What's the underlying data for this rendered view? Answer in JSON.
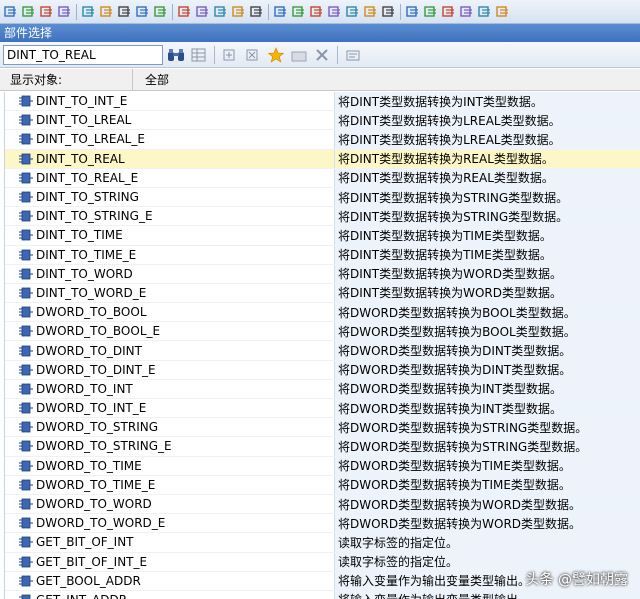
{
  "window": {
    "title": "部件选择"
  },
  "search": {
    "value": "DINT_TO_REAL"
  },
  "filter": {
    "label": "显示对象:",
    "value": "全部"
  },
  "colors": {
    "accent": "#3f72bd",
    "selected_row": "#fdf6c6",
    "desc_bg": "#edf3fb"
  },
  "toolbar_icons": [
    "cut-icon",
    "copy-icon",
    "paste-icon",
    "find-icon",
    "replace-icon",
    "goto-icon",
    "undo-icon",
    "redo-icon",
    "compile-icon",
    "download-icon",
    "upload-icon",
    "monitor-icon",
    "force-icon",
    "network-icon",
    "contact-icon",
    "coil-icon",
    "box-icon",
    "jump-icon",
    "return-icon",
    "comment-icon",
    "zoom-in-icon",
    "zoom-out-icon",
    "bookmark-icon",
    "tag-icon",
    "grid-icon",
    "print-icon",
    "settings-icon"
  ],
  "items": [
    {
      "name": "DINT_TO_INT_E",
      "desc": "将DINT类型数据转换为INT类型数据。"
    },
    {
      "name": "DINT_TO_LREAL",
      "desc": "将DINT类型数据转换为LREAL类型数据。"
    },
    {
      "name": "DINT_TO_LREAL_E",
      "desc": "将DINT类型数据转换为LREAL类型数据。"
    },
    {
      "name": "DINT_TO_REAL",
      "desc": "将DINT类型数据转换为REAL类型数据。",
      "selected": true
    },
    {
      "name": "DINT_TO_REAL_E",
      "desc": "将DINT类型数据转换为REAL类型数据。"
    },
    {
      "name": "DINT_TO_STRING",
      "desc": "将DINT类型数据转换为STRING类型数据。"
    },
    {
      "name": "DINT_TO_STRING_E",
      "desc": "将DINT类型数据转换为STRING类型数据。"
    },
    {
      "name": "DINT_TO_TIME",
      "desc": "将DINT类型数据转换为TIME类型数据。"
    },
    {
      "name": "DINT_TO_TIME_E",
      "desc": "将DINT类型数据转换为TIME类型数据。"
    },
    {
      "name": "DINT_TO_WORD",
      "desc": "将DINT类型数据转换为WORD类型数据。"
    },
    {
      "name": "DINT_TO_WORD_E",
      "desc": "将DINT类型数据转换为WORD类型数据。"
    },
    {
      "name": "DWORD_TO_BOOL",
      "desc": "将DWORD类型数据转换为BOOL类型数据。"
    },
    {
      "name": "DWORD_TO_BOOL_E",
      "desc": "将DWORD类型数据转换为BOOL类型数据。"
    },
    {
      "name": "DWORD_TO_DINT",
      "desc": "将DWORD类型数据转换为DINT类型数据。"
    },
    {
      "name": "DWORD_TO_DINT_E",
      "desc": "将DWORD类型数据转换为DINT类型数据。"
    },
    {
      "name": "DWORD_TO_INT",
      "desc": "将DWORD类型数据转换为INT类型数据。"
    },
    {
      "name": "DWORD_TO_INT_E",
      "desc": "将DWORD类型数据转换为INT类型数据。"
    },
    {
      "name": "DWORD_TO_STRING",
      "desc": "将DWORD类型数据转换为STRING类型数据。"
    },
    {
      "name": "DWORD_TO_STRING_E",
      "desc": "将DWORD类型数据转换为STRING类型数据。"
    },
    {
      "name": "DWORD_TO_TIME",
      "desc": "将DWORD类型数据转换为TIME类型数据。"
    },
    {
      "name": "DWORD_TO_TIME_E",
      "desc": "将DWORD类型数据转换为TIME类型数据。"
    },
    {
      "name": "DWORD_TO_WORD",
      "desc": "将DWORD类型数据转换为WORD类型数据。"
    },
    {
      "name": "DWORD_TO_WORD_E",
      "desc": "将DWORD类型数据转换为WORD类型数据。"
    },
    {
      "name": "GET_BIT_OF_INT",
      "desc": "读取字标签的指定位。"
    },
    {
      "name": "GET_BIT_OF_INT_E",
      "desc": "读取字标签的指定位。"
    },
    {
      "name": "GET_BOOL_ADDR",
      "desc": "将输入变量作为输出变量类型输出。"
    },
    {
      "name": "GET_INT_ADDR",
      "desc": "将输入变量作为输出变量类型输出。"
    }
  ],
  "watermark": {
    "text": "头条 @譬如朝露"
  }
}
